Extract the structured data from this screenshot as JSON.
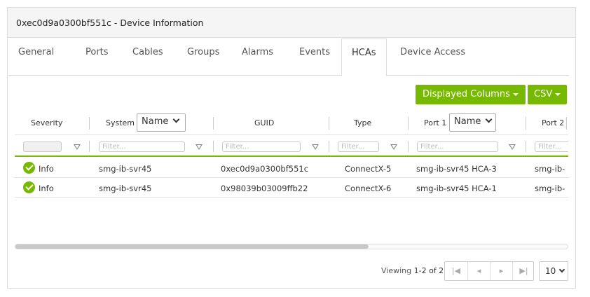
{
  "panel": {
    "title": "0xec0d9a0300bf551c - Device Information"
  },
  "tabs": [
    {
      "label": "General"
    },
    {
      "label": "Ports"
    },
    {
      "label": "Cables"
    },
    {
      "label": "Groups"
    },
    {
      "label": "Alarms"
    },
    {
      "label": "Events"
    },
    {
      "label": "HCAs",
      "active": true
    },
    {
      "label": "Device Access"
    }
  ],
  "toolbar": {
    "displayed_columns_label": "Displayed Columns",
    "csv_label": "CSV"
  },
  "columns": {
    "severity": "Severity",
    "system": "System",
    "system_select": "Name",
    "guid": "GUID",
    "type": "Type",
    "port1": "Port 1",
    "port1_select": "Name",
    "port2": "Port 2"
  },
  "filters": {
    "placeholder": "Filter..."
  },
  "rows": [
    {
      "severity": "Info",
      "system": "smg-ib-svr45",
      "guid": "0xec0d9a0300bf551c",
      "type": "ConnectX-5",
      "port1": "smg-ib-svr45 HCA-3",
      "port2": "smg-ib-"
    },
    {
      "severity": "Info",
      "system": "smg-ib-svr45",
      "guid": "0x98039b03009ffb22",
      "type": "ConnectX-6",
      "port1": "smg-ib-svr45 HCA-1",
      "port2": "smg-ib-"
    }
  ],
  "pagination": {
    "viewing": "Viewing",
    "range": "1-2 of 2",
    "page_size": "10"
  },
  "colors": {
    "accent": "#76b900",
    "severity_info": "#76b900"
  },
  "icons": {
    "severity": "check-circle-icon",
    "filter": "funnel-icon",
    "first": "first-page-icon",
    "prev": "prev-page-icon",
    "next": "next-page-icon",
    "last": "last-page-icon"
  }
}
